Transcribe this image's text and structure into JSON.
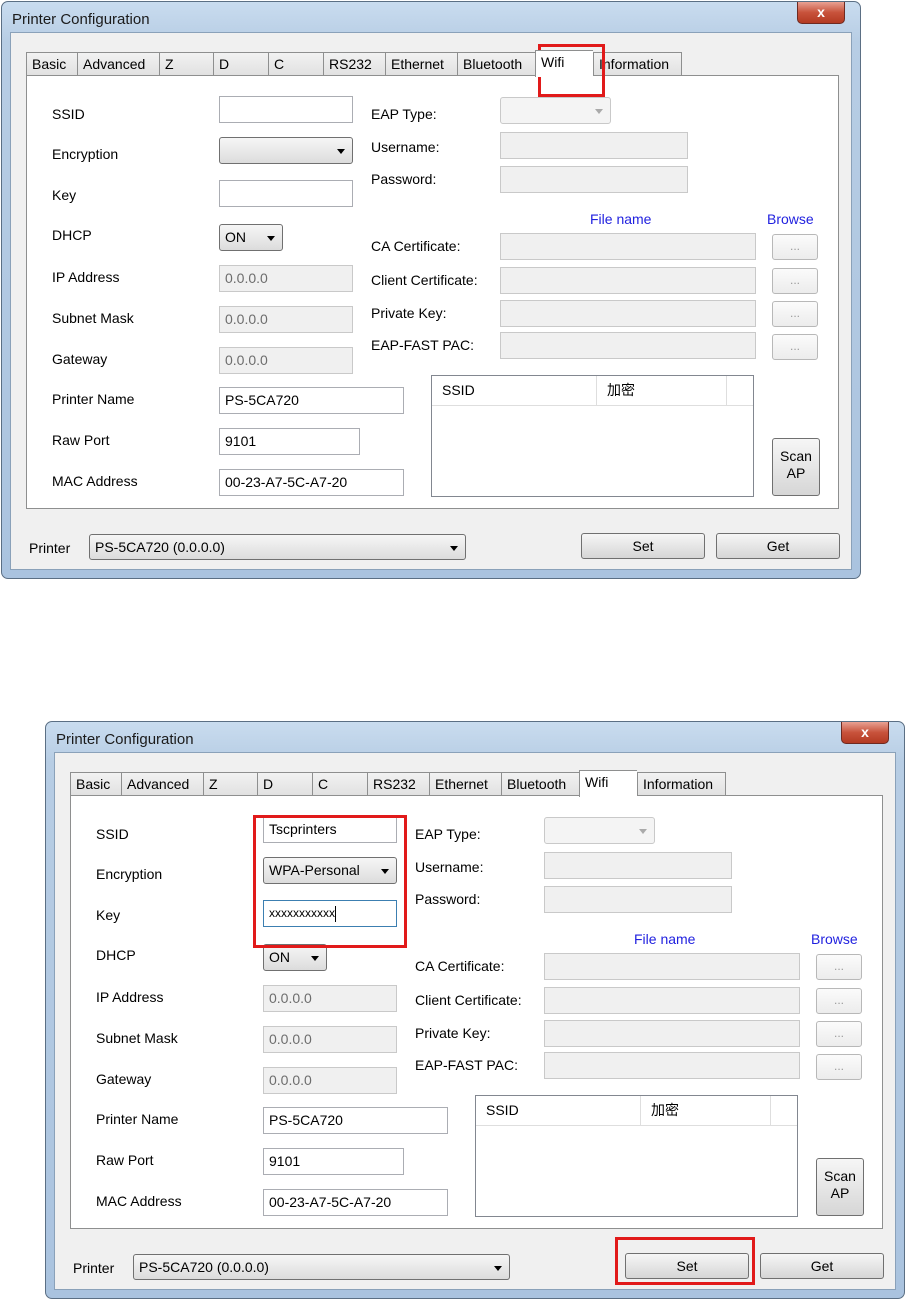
{
  "window": {
    "title": "Printer Configuration",
    "close_symbol": "x"
  },
  "tabs": [
    "Basic",
    "Advanced",
    "Z",
    "D",
    "C",
    "RS232",
    "Ethernet",
    "Bluetooth",
    "Wifi",
    "Information"
  ],
  "labels": {
    "ssid": "SSID",
    "encryption": "Encryption",
    "key": "Key",
    "dhcp": "DHCP",
    "ip_address": "IP Address",
    "subnet_mask": "Subnet Mask",
    "gateway": "Gateway",
    "printer_name": "Printer Name",
    "raw_port": "Raw Port",
    "mac_address": "MAC Address",
    "eap_type": "EAP Type:",
    "username": "Username:",
    "password": "Password:",
    "file_name": "File name",
    "browse": "Browse",
    "ca_certificate": "CA Certificate:",
    "client_certificate": "Client Certificate:",
    "private_key": "Private Key:",
    "eap_fast_pac": "EAP-FAST PAC:",
    "printer": "Printer"
  },
  "browse_button": "...",
  "ap_list": {
    "columns": [
      "SSID",
      "加密"
    ]
  },
  "buttons": {
    "scan_ap_line1": "Scan",
    "scan_ap_line2": "AP",
    "set": "Set",
    "get": "Get"
  },
  "screens": [
    {
      "ssid": "",
      "encryption": "",
      "key": "",
      "dhcp": "ON",
      "ip_address": "0.0.0.0",
      "subnet_mask": "0.0.0.0",
      "gateway": "0.0.0.0",
      "printer_name": "PS-5CA720",
      "raw_port": "9101",
      "mac_address": "00-23-A7-5C-A7-20",
      "printer": "PS-5CA720 (0.0.0.0)"
    },
    {
      "ssid": "Tscprinters",
      "encryption": "WPA-Personal",
      "key": "xxxxxxxxxxx",
      "dhcp": "ON",
      "ip_address": "0.0.0.0",
      "subnet_mask": "0.0.0.0",
      "gateway": "0.0.0.0",
      "printer_name": "PS-5CA720",
      "raw_port": "9101",
      "mac_address": "00-23-A7-5C-A7-20",
      "printer": "PS-5CA720 (0.0.0.0)"
    }
  ],
  "highlight_color": "#e11a1a",
  "link_color": "#1f1fdf"
}
